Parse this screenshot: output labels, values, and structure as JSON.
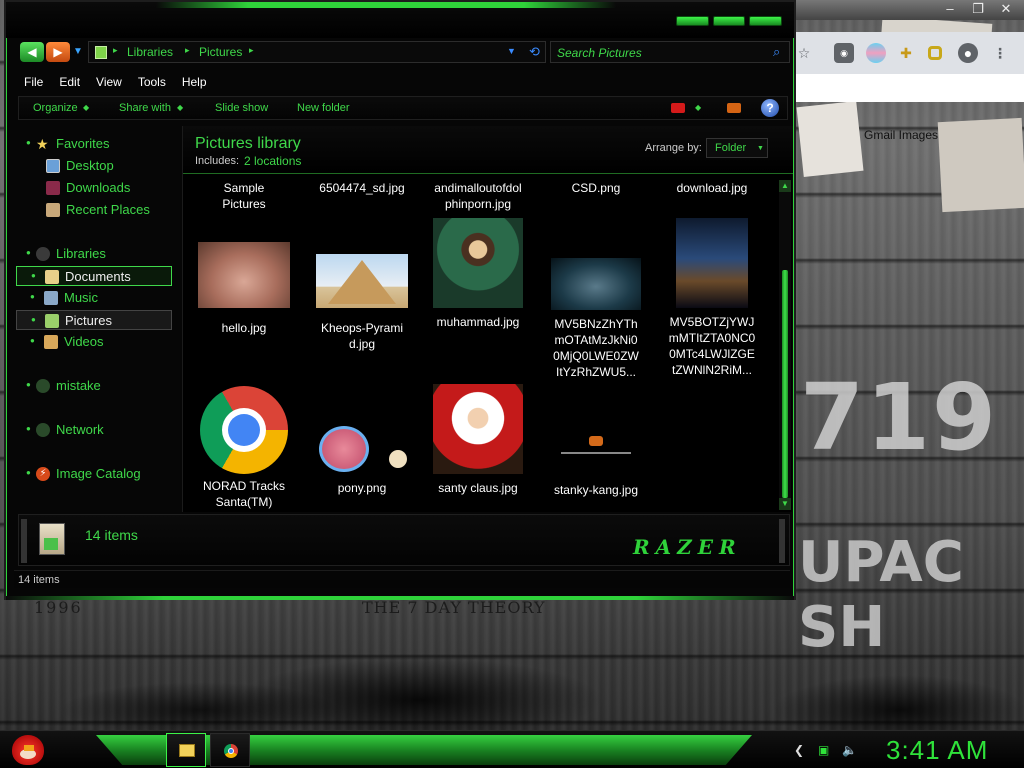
{
  "window": {
    "breadcrumbs": [
      "Libraries",
      "Pictures"
    ],
    "search_placeholder": "Search Pictures"
  },
  "menu": [
    "File",
    "Edit",
    "View",
    "Tools",
    "Help"
  ],
  "command_bar": {
    "organize": "Organize",
    "share_with": "Share with",
    "slide_show": "Slide show",
    "new_folder": "New folder",
    "help": "?"
  },
  "nav_pane": {
    "favorites": "Favorites",
    "desktop": "Desktop",
    "downloads": "Downloads",
    "recent_places": "Recent Places",
    "libraries": "Libraries",
    "documents": "Documents",
    "music": "Music",
    "pictures": "Pictures",
    "videos": "Videos",
    "mistake": "mistake",
    "network": "Network",
    "image_catalog": "Image Catalog"
  },
  "library": {
    "title": "Pictures library",
    "includes_label": "Includes:",
    "includes_link": "2 locations",
    "arrange_label": "Arrange by:",
    "arrange_value": "Folder"
  },
  "files": {
    "row0": [
      "Sample\nPictures",
      "6504474_sd.jpg",
      "andimalloutofdol\nphinporn.jpg",
      "CSD.png",
      "download.jpg"
    ],
    "hello": "hello.jpg",
    "kheops": "Kheops-Pyrami\nd.jpg",
    "muhammad": "muhammad.jpg",
    "mv1": "MV5BNzZhYTh\nmOTAtMzJkNi0\n0MjQ0LWE0ZW\nItYzRhZWU5...",
    "mv2": "MV5BOTZjYWJ\nmMTItZTA0NC0\n0MTc4LWJlZGE\ntZWNlN2RiM...",
    "norad": "NORAD Tracks\nSanta(TM)",
    "pony": "pony.png",
    "santa": "santy claus.jpg",
    "stanky": "stanky-kang.jpg"
  },
  "details": {
    "count": "14 items",
    "brand": "RAZER"
  },
  "status": {
    "text": "14 items"
  },
  "desktop": {
    "year": "1996",
    "album": "THE 7 DAY THEORY",
    "poster_number": "719",
    "poster_name": "UPAC SH",
    "gmail_hint": "Gmail  Images"
  },
  "taskbar": {
    "clock": "3:41 AM"
  },
  "colors": {
    "accent_green": "#3fd84a",
    "window_bg": "#060606",
    "clock_green": "#2fe23a"
  }
}
